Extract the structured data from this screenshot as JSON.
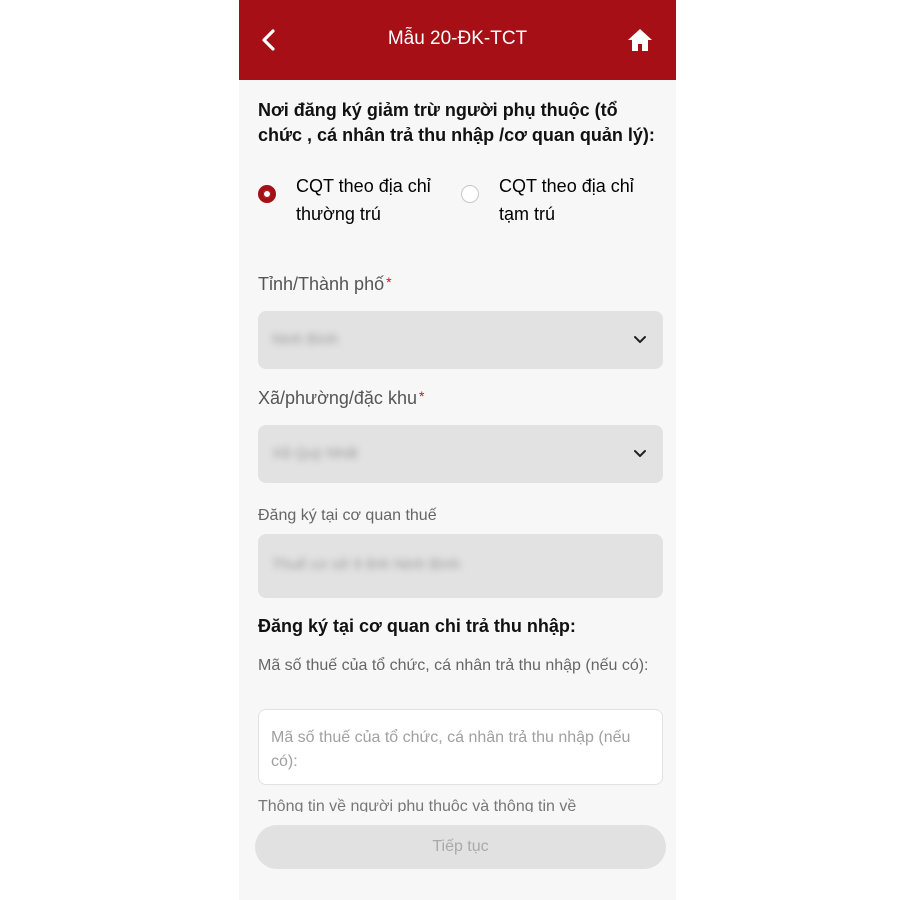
{
  "header": {
    "title": "Mẫu 20-ĐK-TCT",
    "back_icon": "chevron-left-icon",
    "home_icon": "home-icon",
    "bg_color": "#a50f15"
  },
  "form": {
    "place_heading": "Nơi đăng ký giảm trừ người phụ thuộc (tổ chức , cá nhân trả thu nhập /cơ quan quản lý):",
    "radio_options": [
      {
        "label": "CQT theo địa chỉ thường trú",
        "selected": true
      },
      {
        "label": "CQT theo địa chỉ tạm trú",
        "selected": false
      }
    ],
    "province_label": "Tỉnh/Thành phố",
    "province_value": "Ninh Bình",
    "ward_label": "Xã/phường/đặc khu",
    "ward_value": "Xã Quỳ Nhất",
    "tax_office_label": "Đăng ký tại cơ quan thuế",
    "tax_office_value": "Thuế cơ sở 9 tỉnh Ninh Bình",
    "required_mark": "*",
    "payer_heading": "Đăng ký tại cơ quan chi trả thu nhập:",
    "payer_tax_label": "Mã số thuế của tổ chức, cá nhân trả thu nhập (nếu có):",
    "payer_tax_placeholder": "Mã số thuế của tổ chức, cá nhân trả thu nhập (nếu có):",
    "cutoff_text": "Thông tin về người phụ thuộc và thông tin về"
  },
  "footer": {
    "next_label": "Tiếp tục"
  }
}
